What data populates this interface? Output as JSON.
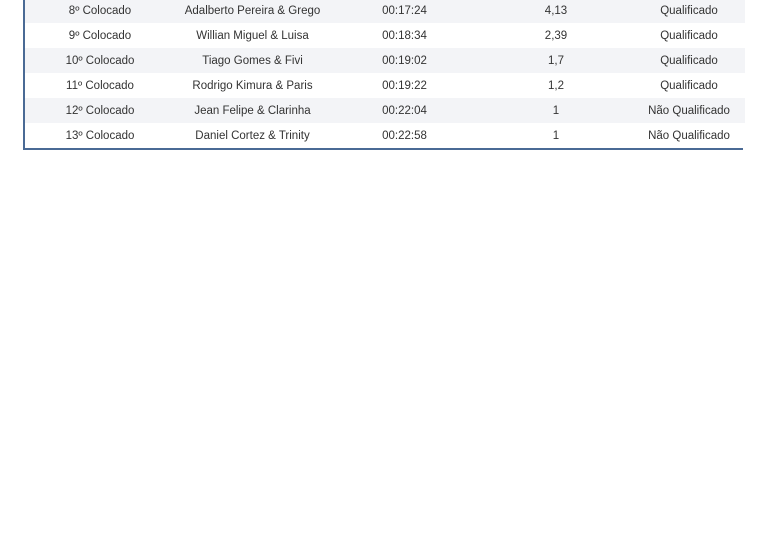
{
  "results": {
    "rows": [
      {
        "position": "8º Colocado",
        "team": "Adalberto Pereira & Grego",
        "time": "00:17:24",
        "score": "4,13",
        "status": "Qualificado"
      },
      {
        "position": "9º Colocado",
        "team": "Willian Miguel & Luisa",
        "time": "00:18:34",
        "score": "2,39",
        "status": "Qualificado"
      },
      {
        "position": "10º Colocado",
        "team": "Tiago Gomes & Fivi",
        "time": "00:19:02",
        "score": "1,7",
        "status": "Qualificado"
      },
      {
        "position": "11º Colocado",
        "team": "Rodrigo Kimura & Paris",
        "time": "00:19:22",
        "score": "1,2",
        "status": "Qualificado"
      },
      {
        "position": "12º Colocado",
        "team": "Jean Felipe & Clarinha",
        "time": "00:22:04",
        "score": "1",
        "status": "Não Qualificado"
      },
      {
        "position": "13º Colocado",
        "team": "Daniel Cortez & Trinity",
        "time": "00:22:58",
        "score": "1",
        "status": "Não Qualificado"
      }
    ]
  }
}
